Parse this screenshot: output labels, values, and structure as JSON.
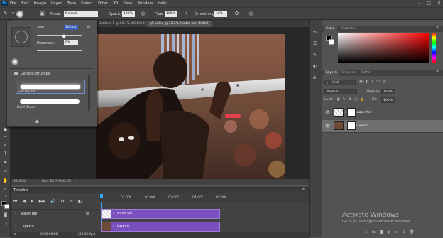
{
  "menu": [
    "File",
    "Edit",
    "Image",
    "Layer",
    "Type",
    "Select",
    "Filter",
    "3D",
    "View",
    "Window",
    "Help"
  ],
  "options": {
    "mode_label": "Mode:",
    "mode_value": "Normal",
    "opacity_label": "Opacity:",
    "opacity_value": "100%",
    "flow_label": "Flow:",
    "flow_value": "100%",
    "smoothing_label": "Smoothing:",
    "smoothing_value": "10%"
  },
  "brush_panel": {
    "size_label": "Size:",
    "size_value": "100 px",
    "hardness_label": "Hardness:",
    "hardness_value": "0%",
    "folder_label": "General Brushes",
    "brush1": "Soft Round",
    "brush2": "Hard Round"
  },
  "tabs": [
    "Untitled-1 @ 66.7% (RGB/8#)",
    "gif video @ 33.3% (water fall, RGB/8)"
  ],
  "status": {
    "zoom": "33.33%",
    "doc": "Doc: 66.7M/86.2M"
  },
  "timeline": {
    "title": "Timeline",
    "ticks": [
      "01:00f",
      "02:00f",
      "03:00f",
      "04:00f",
      "05:00f"
    ],
    "tracks": [
      {
        "name": "water fall",
        "clip": "water fall"
      },
      {
        "name": "Layer 0",
        "clip": "Layer 0"
      }
    ],
    "timecode": "0:00:00:00",
    "fps": "(30.00 fps)"
  },
  "color_panel": {
    "tabs": [
      "Color",
      "Swatches"
    ]
  },
  "layers_panel": {
    "tabs": [
      "Layers",
      "Channels",
      "Paths"
    ],
    "kind_label": "Kind",
    "blend_mode": "Normal",
    "opacity_label": "Opacity:",
    "opacity_value": "100%",
    "lock_label": "Lock:",
    "fill_label": "Fill:",
    "fill_value": "100%",
    "layers": [
      {
        "name": "water fall"
      },
      {
        "name": "Layer 0"
      }
    ]
  },
  "watermark": {
    "title": "Activate Windows",
    "subtitle": "Go to PC settings to activate Windows."
  },
  "colors": {
    "accent": "#7a4fc0",
    "chrome": "#424242",
    "panel": "#535353"
  }
}
